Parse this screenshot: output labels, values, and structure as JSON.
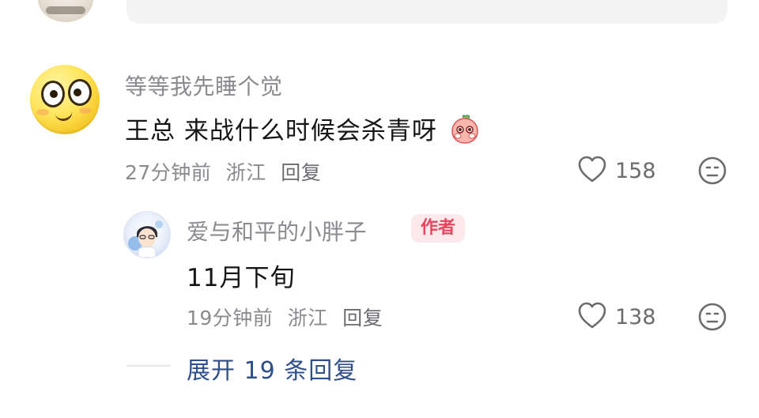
{
  "comment": {
    "username": "等等我先睡个觉",
    "text": "王总 来战什么时候会杀青呀",
    "time": "27分钟前",
    "location": "浙江",
    "reply_label": "回复",
    "likes": "158"
  },
  "reply": {
    "username": "爱与和平的小胖子",
    "badge": "作者",
    "text": "11月下旬",
    "time": "19分钟前",
    "location": "浙江",
    "reply_label": "回复",
    "likes": "138"
  },
  "expand_label": "展开 19 条回复",
  "colors": {
    "username": "#8a8a8f",
    "text": "#161616",
    "badge_bg": "#fde8eb",
    "badge_text": "#e8455f",
    "expand_link": "#2f4f8a"
  },
  "icons": {
    "like": "heart-outline-icon",
    "dislike": "neutral-face-icon",
    "sticker": "shy-peach-sticker-icon"
  }
}
